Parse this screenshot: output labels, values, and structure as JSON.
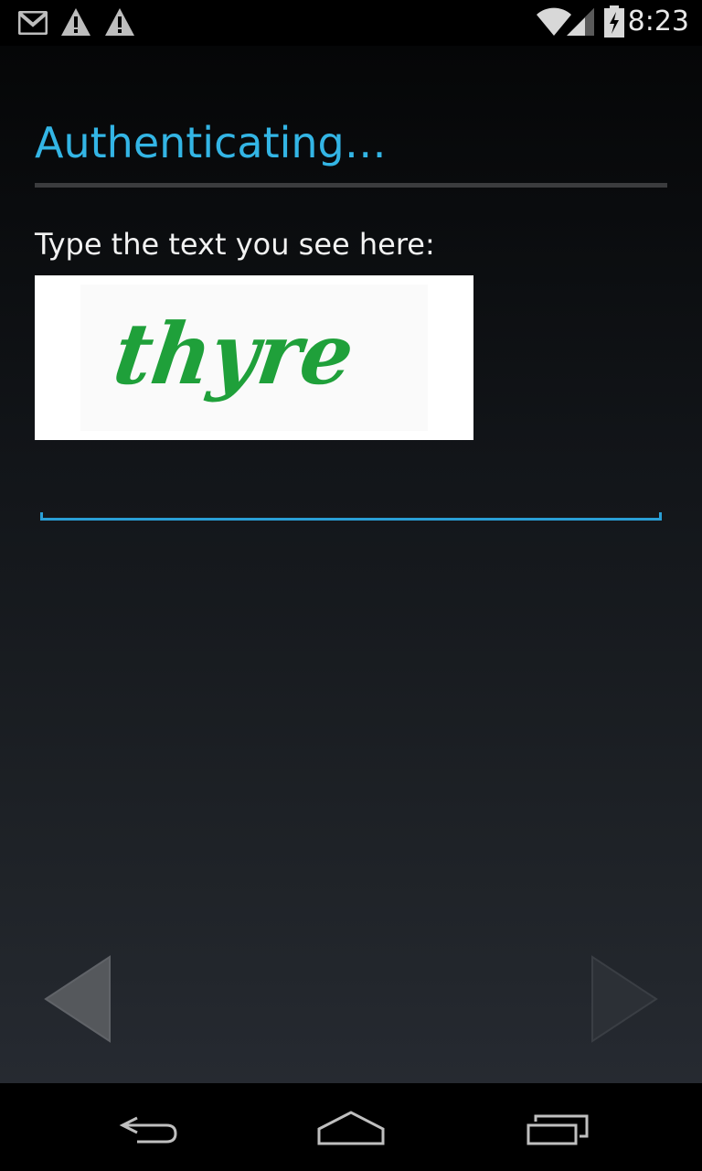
{
  "status_bar": {
    "time": "8:23",
    "left_icons": [
      "gmail-icon",
      "warning-icon",
      "warning-icon"
    ],
    "right_icons": [
      "wifi-icon",
      "signal-icon",
      "battery-charging-icon"
    ]
  },
  "dialog": {
    "title": "Authenticating…",
    "prompt": "Type the text you see here:",
    "captcha_text": "thyre",
    "input": {
      "value": "",
      "placeholder": ""
    }
  },
  "navigation": {
    "prev_icon": "back-arrow-icon",
    "next_icon": "next-arrow-icon"
  },
  "system_nav": {
    "buttons": [
      "back-icon",
      "home-icon",
      "recents-icon"
    ]
  },
  "colors": {
    "accent": "#33b5e5",
    "input_underline": "#2a9fd6",
    "captcha_text": "#1fa03a"
  }
}
